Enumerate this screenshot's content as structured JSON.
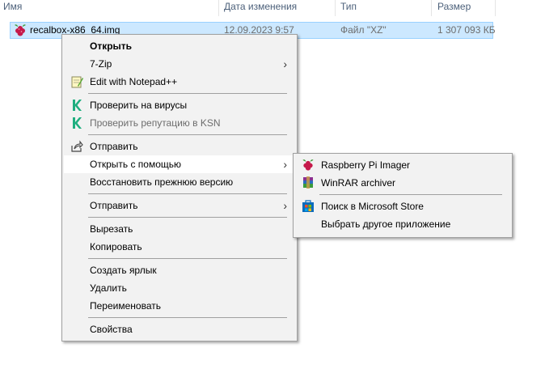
{
  "columns": {
    "name": "Имя",
    "modified": "Дата изменения",
    "type": "Тип",
    "size": "Размер"
  },
  "file": {
    "name": "recalbox-x86_64.img",
    "modified": "12.09.2023 9:57",
    "type": "Файл \"XZ\"",
    "size": "1 307 093 КБ",
    "icon": "raspberry-icon"
  },
  "context_menu": {
    "open": "Открыть",
    "seven_zip": "7-Zip",
    "notepad": "Edit with Notepad++",
    "scan_virus": "Проверить на вирусы",
    "ksn": "Проверить репутацию в KSN",
    "share": "Отправить",
    "open_with": "Открыть с помощью",
    "restore": "Восстановить прежнюю версию",
    "send_to": "Отправить",
    "cut": "Вырезать",
    "copy": "Копировать",
    "shortcut": "Создать ярлык",
    "delete": "Удалить",
    "rename": "Переименовать",
    "properties": "Свойства"
  },
  "submenu": {
    "rpi_imager": "Raspberry Pi Imager",
    "winrar": "WinRAR archiver",
    "store": "Поиск в Microsoft Store",
    "other_app": "Выбрать другое приложение"
  },
  "colors": {
    "selection": "#cce8ff",
    "menu_bg": "#f2f2f2",
    "kaspersky": "#1fae7f"
  }
}
